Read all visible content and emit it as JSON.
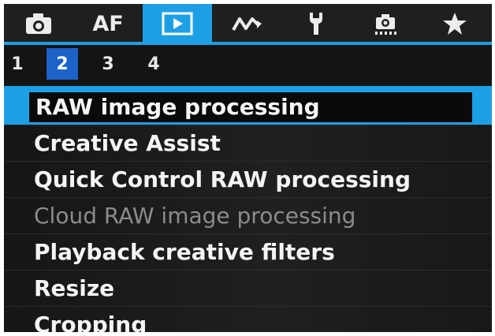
{
  "tabs": [
    {
      "label": "",
      "icon": "camera-icon"
    },
    {
      "label": "AF",
      "icon": ""
    },
    {
      "label": "",
      "icon": "playback-icon",
      "active": true
    },
    {
      "label": "",
      "icon": "wireless-icon"
    },
    {
      "label": "",
      "icon": "wrench-icon"
    },
    {
      "label": "",
      "icon": "custom-functions-icon"
    },
    {
      "label": "",
      "icon": "star-icon"
    }
  ],
  "pages": [
    "1",
    "2",
    "3",
    "4"
  ],
  "active_page": "2",
  "menu": {
    "items": [
      {
        "label": "RAW image processing",
        "selected": true
      },
      {
        "label": "Creative Assist"
      },
      {
        "label": "Quick Control RAW processing"
      },
      {
        "label": "Cloud RAW image processing",
        "disabled": true
      },
      {
        "label": "Playback creative filters"
      },
      {
        "label": "Resize"
      },
      {
        "label": "Cropping"
      }
    ]
  },
  "colors": {
    "accent": "#1d9fe6",
    "page_highlight": "#1d62c8",
    "background": "#141414"
  }
}
